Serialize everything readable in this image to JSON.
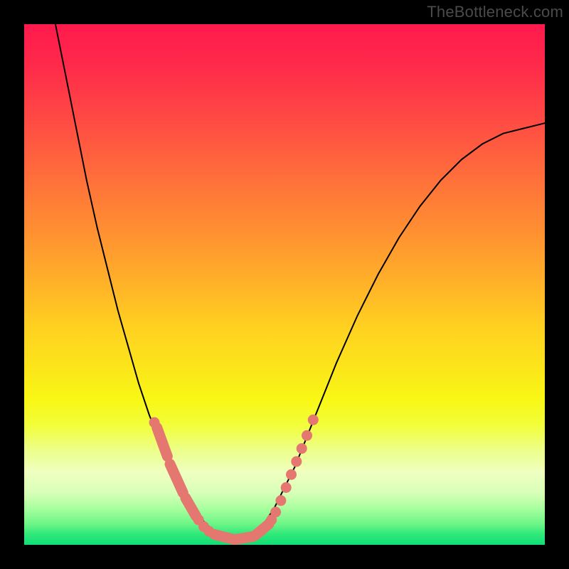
{
  "watermark": "TheBottleneck.com",
  "chart_data": {
    "type": "line",
    "title": "",
    "xlabel": "",
    "ylabel": "",
    "xlim": [
      0,
      100
    ],
    "ylim": [
      0,
      100
    ],
    "grid": false,
    "legend": false,
    "series": [
      {
        "name": "curve",
        "x": [
          6,
          8,
          10,
          12,
          14,
          16,
          18,
          20,
          22,
          24,
          26,
          28,
          30,
          32,
          34,
          36,
          38,
          40,
          42,
          44,
          46,
          48,
          50,
          52,
          54,
          56,
          58,
          60,
          64,
          68,
          72,
          76,
          80,
          84,
          88,
          92,
          96,
          100
        ],
        "y": [
          100,
          90,
          80,
          70,
          61,
          53,
          45,
          38,
          31,
          25,
          20,
          15,
          11,
          8,
          5,
          3,
          2,
          1,
          1,
          2,
          4,
          7,
          11,
          15,
          20,
          25,
          30,
          35,
          44,
          52,
          59,
          65,
          70,
          74,
          77,
          79,
          80,
          81
        ]
      }
    ],
    "markers": {
      "left_pills": [
        {
          "x1": 25.5,
          "y1": 22.5,
          "x2": 27.5,
          "y2": 17.0
        },
        {
          "x1": 28.0,
          "y1": 15.5,
          "x2": 30.5,
          "y2": 10.0
        },
        {
          "x1": 31.0,
          "y1": 9.0,
          "x2": 33.0,
          "y2": 5.5
        }
      ],
      "left_dots": [
        {
          "x": 25.0,
          "y": 23.5
        },
        {
          "x": 33.5,
          "y": 4.8
        },
        {
          "x": 34.5,
          "y": 3.5
        },
        {
          "x": 35.5,
          "y": 2.6
        }
      ],
      "bottom_pills": [
        {
          "x1": 36.5,
          "y1": 2.0,
          "x2": 40.0,
          "y2": 1.1
        },
        {
          "x1": 40.5,
          "y1": 1.0,
          "x2": 44.0,
          "y2": 1.6
        },
        {
          "x1": 44.5,
          "y1": 1.9,
          "x2": 47.0,
          "y2": 4.0
        }
      ],
      "right_dots": [
        {
          "x": 47.5,
          "y": 4.8
        },
        {
          "x": 48.3,
          "y": 6.3
        },
        {
          "x": 49.3,
          "y": 8.5
        },
        {
          "x": 50.3,
          "y": 11.0
        },
        {
          "x": 51.3,
          "y": 13.5
        },
        {
          "x": 52.3,
          "y": 16.0
        },
        {
          "x": 53.3,
          "y": 18.5
        },
        {
          "x": 54.3,
          "y": 21.0
        },
        {
          "x": 55.5,
          "y": 24.0
        }
      ]
    }
  }
}
